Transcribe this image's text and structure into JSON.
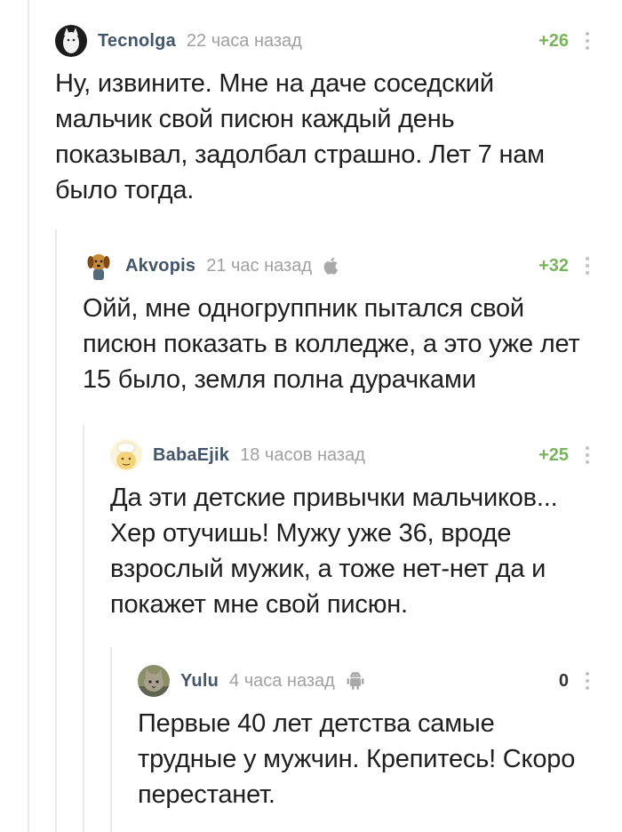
{
  "comments": [
    {
      "username": "Tecnolga",
      "time": "22 часа назад",
      "rating": "+26",
      "platform_icon": "",
      "avatar_icon": "cat-avatar-icon",
      "text_lines": [
        "Ну, извините. Мне на даче соседский",
        "мальчик свой писюн каждый день",
        "показывал, задолбал страшно. Лет 7 нам",
        "было тогда."
      ]
    },
    {
      "username": "Akvopis",
      "time": "21 час назад",
      "rating": "+32",
      "platform_icon": "apple-icon",
      "avatar_icon": "dog-avatar-icon",
      "text_lines": [
        "Ойй, мне одногруппник пытался свой",
        "писюн показать в колледже, а это уже лет",
        "15 было, земля полна дурачками"
      ]
    },
    {
      "username": "BabaEjik",
      "time": "18 часов назад",
      "rating": "+25",
      "platform_icon": "",
      "avatar_icon": "chef-avatar-icon",
      "text_lines": [
        "Да эти детские привычки мальчиков...",
        "Хер отучишь! Мужу уже 36, вроде",
        "взрослый мужик, а тоже нет-нет да и",
        "покажет мне свой писюн."
      ]
    },
    {
      "username": "Yulu",
      "time": "4 часа назад",
      "rating": "0",
      "platform_icon": "android-icon",
      "avatar_icon": "cat-photo-avatar-icon",
      "text_lines": [
        "Первые 40 лет детства самые",
        "трудные у мужчин. Крепитесь! Скоро",
        "перестанет."
      ]
    }
  ],
  "colors": {
    "username": "#41566b",
    "time": "#a0a0a0",
    "rating_positive": "#78b35b",
    "thread_line": "#e9e9e9",
    "text": "#1f1f1f"
  }
}
